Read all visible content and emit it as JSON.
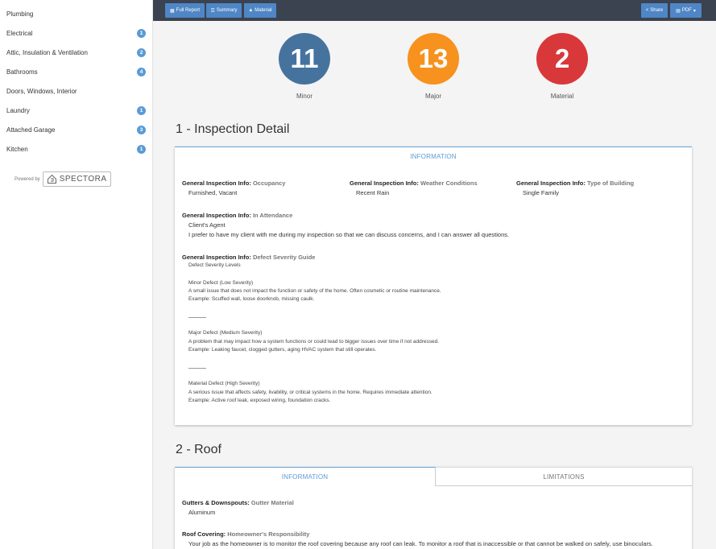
{
  "sidebar": {
    "items": [
      {
        "label": "Plumbing",
        "count": ""
      },
      {
        "label": "Electrical",
        "count": "1"
      },
      {
        "label": "Attic, Insulation & Ventilation",
        "count": "2"
      },
      {
        "label": "Bathrooms",
        "count": "4"
      },
      {
        "label": "Doors, Windows, Interior",
        "count": ""
      },
      {
        "label": "Laundry",
        "count": "1"
      },
      {
        "label": "Attached Garage",
        "count": "3"
      },
      {
        "label": "Kitchen",
        "count": "1"
      }
    ],
    "powered_by": "Powered by",
    "brand": "SPECTORA"
  },
  "toolbar": {
    "full_report": "Full Report",
    "summary": "Summary",
    "material": "Material",
    "share": "Share",
    "pdf": "PDF"
  },
  "summary": {
    "minor": {
      "count": "11",
      "label": "Minor",
      "color": "#46739e"
    },
    "major": {
      "count": "13",
      "label": "Major",
      "color": "#f7921e"
    },
    "material": {
      "count": "2",
      "label": "Material",
      "color": "#d9383a"
    }
  },
  "section1": {
    "title": "1 - Inspection Detail",
    "tab": "INFORMATION",
    "occupancy": {
      "prefix": "General Inspection Info: ",
      "name": "Occupancy",
      "value": "Furnished, Vacant"
    },
    "weather": {
      "prefix": "General Inspection Info: ",
      "name": "Weather Conditions",
      "value": "Recent Rain"
    },
    "building": {
      "prefix": "General Inspection Info: ",
      "name": "Type of Building",
      "value": "Single Family"
    },
    "attendance": {
      "prefix": "General Inspection Info: ",
      "name": "In Attendance",
      "value": "Client's Agent",
      "note": "I prefer to have my client with me during my inspection so that we can discuss concerns, and I can answer all questions."
    },
    "severity": {
      "prefix": "General Inspection Info: ",
      "name": "Defect Severity Guide",
      "value": "Defect Severity Levels",
      "minor_title": "Minor Defect (Low Severity)",
      "minor_desc": "A small issue that does not impact the function or safety of the home. Often cosmetic or routine maintenance.",
      "minor_example": "Example: Scuffed wall, loose doorknob, missing caulk.",
      "major_title": "Major Defect (Medium Severity)",
      "major_desc": "A problem that may impact how a system functions or could lead to bigger issues over time if not addressed.",
      "major_example": "Example: Leaking faucet, clogged gutters, aging HVAC system that still operates.",
      "material_title": "Material Defect (High Severity)",
      "material_desc": "A serious issue that affects safety, livability, or critical systems in the home. Requires immediate attention.",
      "material_example": "Example: Active roof leak, exposed wiring, foundation cracks."
    }
  },
  "section2": {
    "title": "2 - Roof",
    "tab_info": "INFORMATION",
    "tab_limitations": "LIMITATIONS",
    "gutters": {
      "prefix": "Gutters & Downspouts: ",
      "name": "Gutter Material",
      "value": "Aluminum"
    },
    "covering": {
      "prefix": "Roof Covering: ",
      "name": "Homeowner's Responsibility",
      "value": "Your job as the homeowner is to monitor the roof covering because any roof can leak. To monitor a roof that is inaccessible or that cannot be walked on safely, use binoculars."
    }
  }
}
